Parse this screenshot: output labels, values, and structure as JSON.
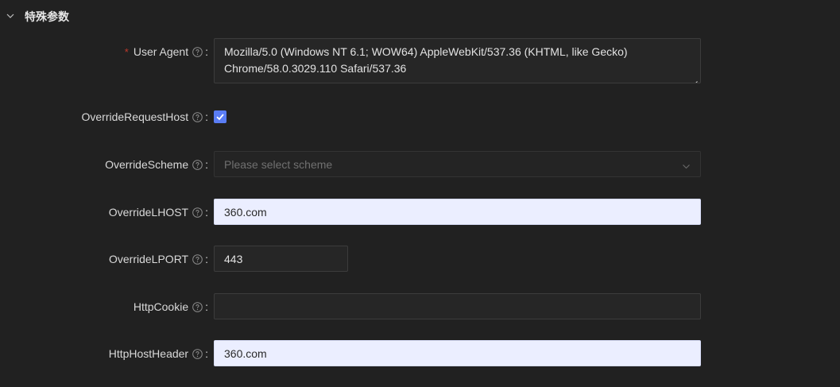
{
  "section": {
    "title": "特殊参数",
    "icon": "chevron-down-icon"
  },
  "fields": {
    "user_agent": {
      "label": "User Agent",
      "required": true,
      "required_mark": "*",
      "colon": ":",
      "value_line1": "Mozilla/5.0 (Windows NT 6.1; WOW64) AppleWebKit/537.36 (KHTML, like Gecko)",
      "value_line2": "Chrome/58.0.3029.110 Safari/537.36"
    },
    "override_request_host": {
      "label": "OverrideRequestHost",
      "colon": ":",
      "checked": true
    },
    "override_scheme": {
      "label": "OverrideScheme",
      "colon": ":",
      "placeholder": "Please select scheme",
      "value": ""
    },
    "override_lhost": {
      "label": "OverrideLHOST",
      "colon": ":",
      "value": "360.com"
    },
    "override_lport": {
      "label": "OverrideLPORT",
      "colon": ":",
      "value": "443"
    },
    "http_cookie": {
      "label": "HttpCookie",
      "colon": ":",
      "value": ""
    },
    "http_host_header": {
      "label": "HttpHostHeader",
      "colon": ":",
      "value": "360.com"
    }
  },
  "colors": {
    "background": "#212121",
    "checkbox_accent": "#5a7df5",
    "required_mark": "#c0392b",
    "filled_input_bg": "#ebeeff"
  }
}
